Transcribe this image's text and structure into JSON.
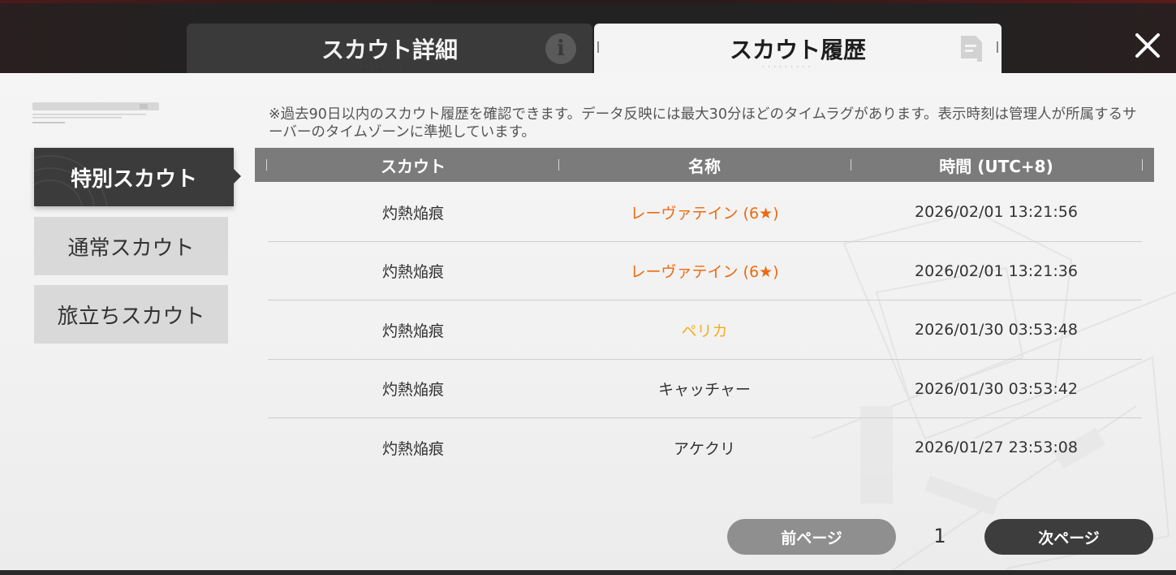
{
  "tabs": {
    "detail_label": "スカウト詳細",
    "history_label": "スカウト履歴"
  },
  "sidebar": {
    "items": [
      {
        "label": "特別スカウト",
        "active": true
      },
      {
        "label": "通常スカウト",
        "active": false
      },
      {
        "label": "旅立ちスカウト",
        "active": false
      }
    ]
  },
  "notice": "※過去90日以内のスカウト履歴を確認できます。データ反映には最大30分ほどのタイムラグがあります。表示時刻は管理人が所属するサーバーのタイムゾーンに準拠しています。",
  "table": {
    "headers": [
      "スカウト",
      "名称",
      "時間 (UTC+8)"
    ],
    "rows": [
      {
        "scout": "灼熱焔痕",
        "name": "レーヴァテイン (6★)",
        "time": "2026/02/01 13:21:56",
        "name_color": "#ee6a10"
      },
      {
        "scout": "灼熱焔痕",
        "name": "レーヴァテイン (6★)",
        "time": "2026/02/01 13:21:36",
        "name_color": "#ee6a10"
      },
      {
        "scout": "灼熱焔痕",
        "name": "ペリカ",
        "time": "2026/01/30 03:53:48",
        "name_color": "#f0b020"
      },
      {
        "scout": "灼熱焔痕",
        "name": "キャッチャー",
        "time": "2026/01/30 03:53:42",
        "name_color": "#333333"
      },
      {
        "scout": "灼熱焔痕",
        "name": "アケクリ",
        "time": "2026/01/27 23:53:08",
        "name_color": "#333333"
      }
    ]
  },
  "pager": {
    "prev_label": "前ページ",
    "next_label": "次ページ",
    "page": "1"
  },
  "icons": {
    "info": "info-icon",
    "history": "document-icon",
    "close": "close-icon"
  }
}
